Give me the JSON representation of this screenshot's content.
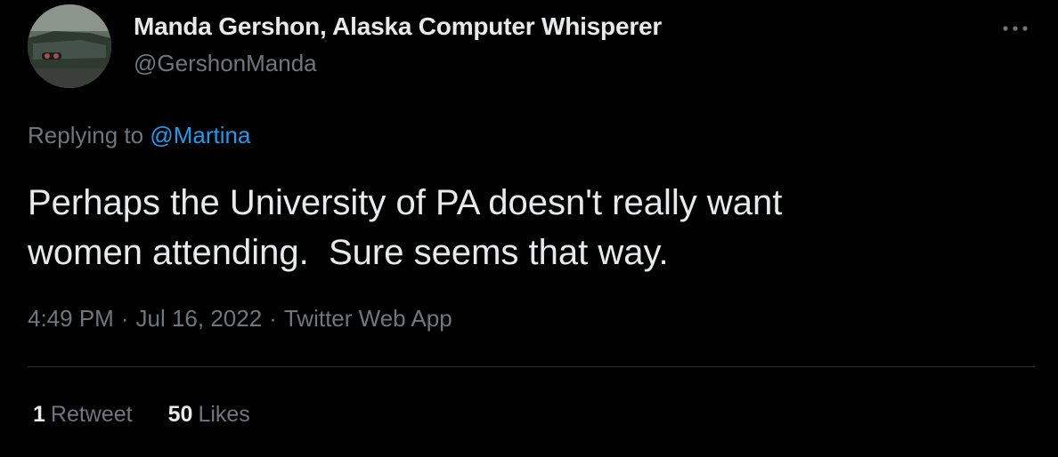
{
  "author": {
    "display_name": "Manda Gershon, Alaska Computer Whisperer",
    "handle": "@GershonManda",
    "avatar_icon": "classic-car-photo"
  },
  "reply": {
    "prefix": "Replying to ",
    "mention": "@Martina"
  },
  "tweet": {
    "text": "Perhaps the University of PA doesn't really want\nwomen attending.  Sure seems that way."
  },
  "meta": {
    "time": "4:49 PM",
    "separator": "·",
    "date": "Jul 16, 2022",
    "source": "Twitter Web App"
  },
  "stats": {
    "retweets_count": "1",
    "retweets_label": "Retweet",
    "likes_count": "50",
    "likes_label": "Likes"
  },
  "colors": {
    "background": "#000000",
    "text_primary": "#e7e9ea",
    "text_secondary": "#71767b",
    "accent": "#1d9bf0",
    "divider": "#2f3336"
  },
  "icons": {
    "more": "more-horizontal-icon"
  }
}
